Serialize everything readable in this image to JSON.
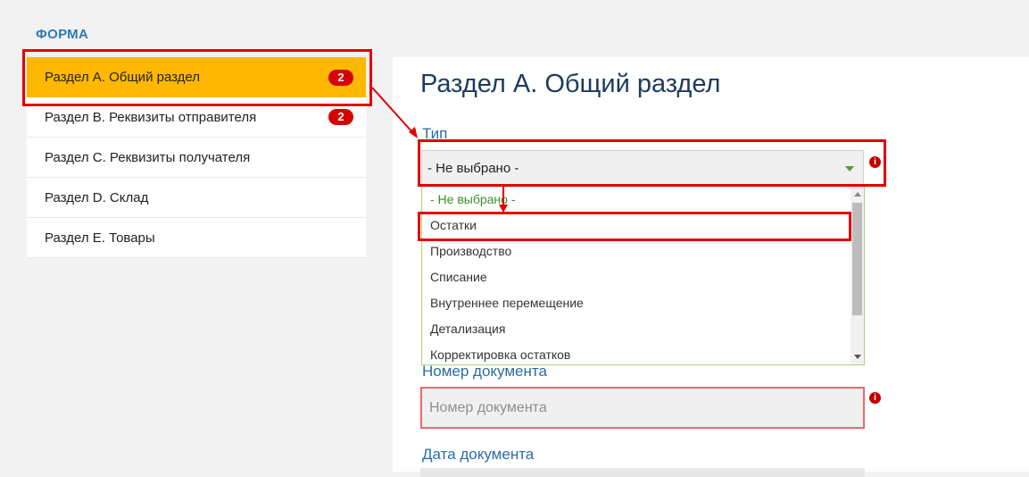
{
  "form": {
    "title": "ФОРМА"
  },
  "sidebar": {
    "items": [
      {
        "label": "Раздел A. Общий раздел",
        "badge": "2",
        "active": true
      },
      {
        "label": "Раздел B. Реквизиты отправителя",
        "badge": "2",
        "active": false
      },
      {
        "label": "Раздел C. Реквизиты получателя",
        "badge": "",
        "active": false
      },
      {
        "label": "Раздел D. Склад",
        "badge": "",
        "active": false
      },
      {
        "label": "Раздел E. Товары",
        "badge": "",
        "active": false
      }
    ]
  },
  "main": {
    "section_title": "Раздел A. Общий раздел",
    "type_field": {
      "label": "Тип",
      "selected_value": "- Не выбрано -",
      "options": [
        "- Не выбрано -",
        "Остатки",
        "Производство",
        "Списание",
        "Внутреннее перемещение",
        "Детализация",
        "Корректировка остатков"
      ]
    },
    "doc_number_field": {
      "label": "Номер документа",
      "placeholder": "Номер документа"
    },
    "doc_date_field": {
      "label": "Дата документа"
    }
  },
  "icons": {
    "info": "info-icon",
    "dropdown_arrow": "chevron-down-icon"
  },
  "colors": {
    "active_item": "#ffb800",
    "badge": "#d60000",
    "highlight": "#e20000",
    "title": "#1c3a5e",
    "label": "#2a6ca8",
    "selected_option": "#3c8c2a",
    "error_border": "#e26d6d"
  }
}
